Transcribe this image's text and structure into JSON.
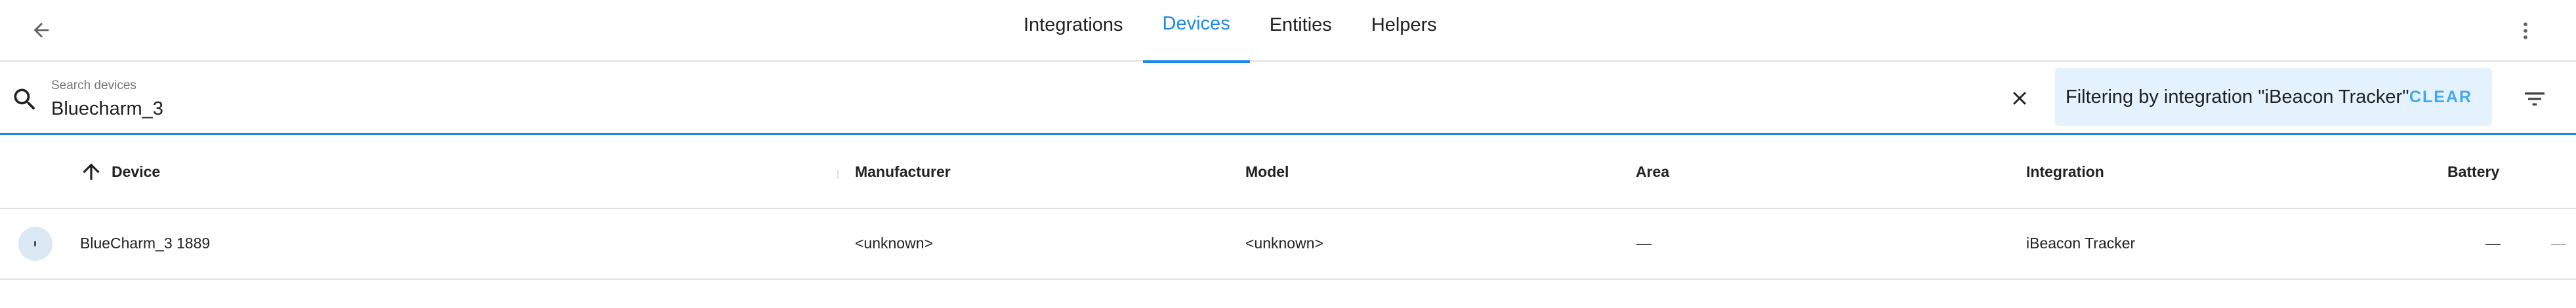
{
  "topbar": {
    "tabs": [
      {
        "label": "Integrations",
        "active": false
      },
      {
        "label": "Devices",
        "active": true
      },
      {
        "label": "Entities",
        "active": false
      },
      {
        "label": "Helpers",
        "active": false
      }
    ],
    "back_icon": "arrow-left-icon",
    "menu_icon": "dots-vertical-icon"
  },
  "search": {
    "label": "Search devices",
    "value": "Bluecharm_3",
    "icon": "magnify-icon",
    "clear_icon": "close-icon"
  },
  "filter": {
    "text": "Filtering by integration \"iBeacon Tracker\"",
    "clear_label": "CLEAR",
    "icon": "filter-variant-icon"
  },
  "table": {
    "columns": {
      "device": "Device",
      "manufacturer": "Manufacturer",
      "model": "Model",
      "area": "Area",
      "integration": "Integration",
      "battery": "Battery"
    },
    "sort_icon": "arrow-up-icon",
    "rows": [
      {
        "device": "BlueCharm_3 1889",
        "manufacturer": "<unknown>",
        "model": "<unknown>",
        "area": "—",
        "integration": "iBeacon Tracker",
        "battery": "—",
        "extra": "—"
      }
    ]
  },
  "colors": {
    "accent": "#1e88e5",
    "chip_background": "#e3f2fd",
    "chip_action": "#42a5f5",
    "divider": "#e0e0e0"
  }
}
